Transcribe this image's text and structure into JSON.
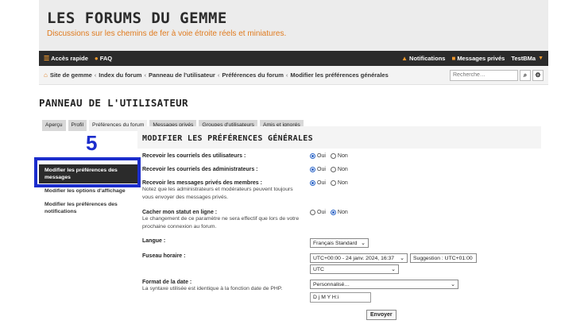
{
  "site": {
    "title": "LES FORUMS DU GEMME",
    "description": "Discussions sur les chemins de fer à voie étroite réels et miniatures."
  },
  "navbar": {
    "quick_access": "Accès rapide",
    "faq": "FAQ",
    "notifications": "Notifications",
    "private_messages": "Messages privés",
    "username": "TestBMa",
    "accent_color": "#f29a2e"
  },
  "breadcrumb": {
    "items": [
      "Site de gemme",
      "Index du forum",
      "Panneau de l'utilisateur",
      "Préférences du forum",
      "Modifier les préférences générales"
    ],
    "separator": "‹"
  },
  "search": {
    "placeholder": "Recherche…"
  },
  "page": {
    "title": "PANNEAU DE L'UTILISATEUR"
  },
  "tabs": [
    "Aperçu",
    "Profil",
    "Préférences du forum",
    "Messages privés",
    "Groupes d'utilisateurs",
    "Amis et ignorés"
  ],
  "menu": {
    "items": [
      "Modifier les préférences des messages",
      "Modifier les options d'affichage",
      "Modifier les préférences des notifications"
    ]
  },
  "form": {
    "title": "MODIFIER LES PRÉFÉRENCES GÉNÉRALES",
    "yes": "Oui",
    "no": "Non",
    "users_mail": "Recevoir les courriels des utilisateurs :",
    "admin_mail": "Recevoir les courriels des administrateurs :",
    "pm_label": "Recevoir les messages privés des membres :",
    "pm_expl": "Notez que les administrateurs et modérateurs peuvent toujours vous envoyer des messages privés.",
    "hide_label": "Cacher mon statut en ligne :",
    "hide_expl": "Le changement de ce paramètre ne sera effectif que lors de votre prochaine connexion au forum.",
    "lang_label": "Langue :",
    "lang_value": "Français Standard",
    "tz_label": "Fuseau horaire :",
    "tz_value": "UTC+00:00 - 24 janv. 2024, 16:37",
    "tz_suggestion": "Suggestion : UTC+01:00",
    "tz_zone": "UTC",
    "date_label": "Format de la date :",
    "date_expl": "La syntaxe utilisée est identique à la fonction date de PHP.",
    "date_select": "Personnalisé…",
    "date_value": "D j M Y H:i",
    "submit": "Envoyer"
  },
  "annotation": {
    "number": "5",
    "color": "#1b2dcc"
  }
}
